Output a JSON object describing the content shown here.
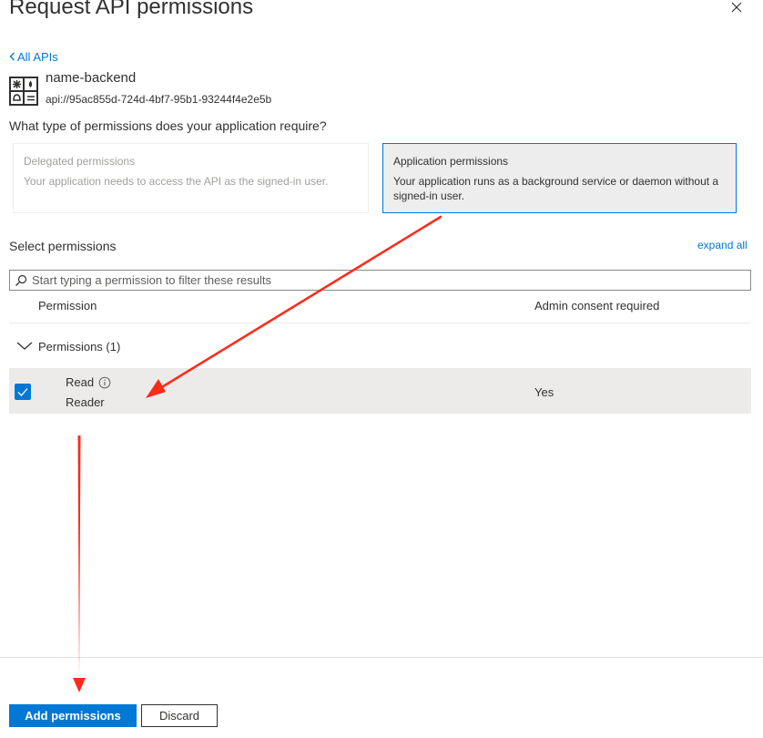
{
  "panel": {
    "title": "Request API permissions",
    "close_icon": "close-icon"
  },
  "nav": {
    "back_label": "All APIs"
  },
  "api": {
    "name": "name-backend",
    "uri": "api://95ac855d-724d-4bf7-95b1-93244f4e2e5b",
    "icon": "api-app-icon"
  },
  "question": "What type of permissions does your application require?",
  "permission_types": [
    {
      "title": "Delegated permissions",
      "description": "Your application needs to access the API as the signed-in user.",
      "selected": false
    },
    {
      "title": "Application permissions",
      "description": "Your application runs as a background service or daemon without a signed-in user.",
      "selected": true
    }
  ],
  "select_section": {
    "label": "Select permissions",
    "expand_label": "expand all",
    "search_placeholder": "Start typing a permission to filter these results",
    "search_value": ""
  },
  "table": {
    "columns": [
      "Permission",
      "Admin consent required"
    ],
    "groups": [
      {
        "label": "Permissions (1)",
        "expanded": true,
        "rows": [
          {
            "name": "Read",
            "display": "Reader",
            "admin_consent": "Yes",
            "checked": true
          }
        ]
      }
    ]
  },
  "footer": {
    "add_label": "Add permissions",
    "discard_label": "Discard"
  },
  "colors": {
    "accent": "#0078d4",
    "annotation_arrow": "#ff2a1a",
    "selected_card_bg": "#ededed",
    "row_bg": "#edebe9"
  }
}
